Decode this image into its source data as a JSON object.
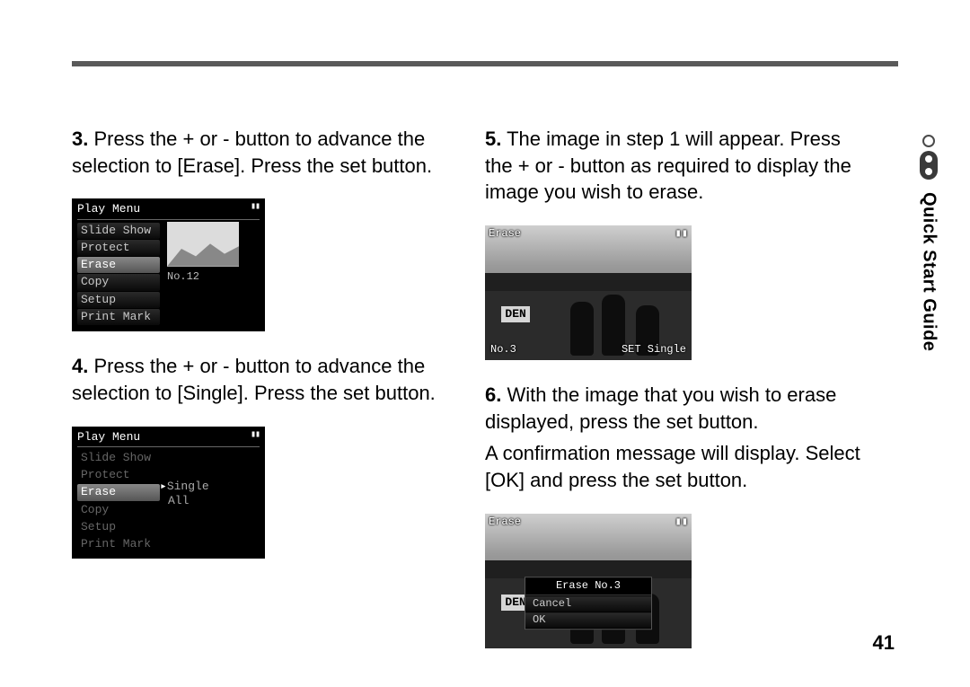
{
  "page_number": "41",
  "side_tab": {
    "label": "Quick Start Guide"
  },
  "steps": {
    "s3": {
      "num": "3.",
      "text": "Press the + or - button to advance the selection to [Erase]. Press the set button."
    },
    "s4": {
      "num": "4.",
      "text": "Press the + or - button to advance the selection to [Single]. Press the set button."
    },
    "s5": {
      "num": "5.",
      "text": "The image in step 1 will appear. Press the + or - button as required to display the image you wish to erase."
    },
    "s6": {
      "num": "6.",
      "text": "With the image that you wish to erase displayed, press the set button.",
      "sub": "A confirmation message will display. Select [OK] and press the set button."
    }
  },
  "screen_playmenu_1": {
    "title": "Play Menu",
    "items": [
      "Slide Show",
      "Protect",
      "Erase",
      "Copy",
      "Setup",
      "Print Mark"
    ],
    "selected_index": 2,
    "preview_label": "No.12"
  },
  "screen_playmenu_2": {
    "title": "Play Menu",
    "items": [
      "Slide Show",
      "Protect",
      "Erase",
      "Copy",
      "Setup",
      "Print Mark"
    ],
    "selected_index": 2,
    "submenu": {
      "options": [
        "Single",
        "All"
      ],
      "arrow_before": 0
    }
  },
  "screen_erase_browse": {
    "title": "Erase",
    "bottom_left": "No.3",
    "bottom_right": "SET Single",
    "sign_text": "DEN"
  },
  "screen_erase_confirm": {
    "title": "Erase",
    "sign_text": "DEN",
    "dialog": {
      "title": "Erase No.3",
      "options": [
        "Cancel",
        "OK"
      ]
    }
  }
}
